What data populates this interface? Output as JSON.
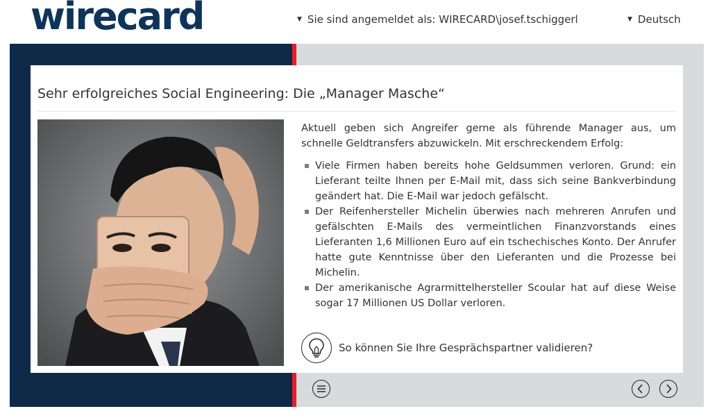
{
  "header": {
    "logo_text": "wirecard",
    "logged_in_label": "Sie sind angemeldet als: WIRECARD\\josef.tschiggerl",
    "language_label": "Deutsch"
  },
  "slide": {
    "title": "Sehr erfolgreiches Social Engineering: Die „Manager Masche“",
    "intro": "Aktuell geben sich Angreifer gerne als führende Manager aus, um schnelle Geldtransfers abzuwickeln. Mit erschreckendem Erfolg:",
    "bullets": [
      "Viele Firmen haben bereits hohe Geldsummen verloren. Grund: ein Lieferant teilte Ihnen per E-Mail mit, dass sich seine Bankverbindung geändert hat. Die E-Mail war jedoch gefälscht.",
      "Der Reifenhersteller Michelin überwies nach mehreren Anrufen und gefälschten E-Mails des vermeintlichen Finanzvorstands eines Lieferanten 1,6 Millionen Euro auf ein tschechisches Konto. Der Anrufer hatte gute Kenntnisse über den Lieferanten und die Prozesse bei Michelin.",
      "Der amerikanische Agrarmittelhersteller Scoular hat auf diese Weise sogar 17 Millionen US Dollar verloren."
    ],
    "tip_label": "So können Sie Ihre Gesprächspartner validieren?"
  },
  "icons": {
    "dropdown": "caret-down-icon",
    "tip": "lightbulb-icon",
    "menu": "menu-icon",
    "prev": "chevron-left-icon",
    "next": "chevron-right-icon"
  },
  "colors": {
    "brand_navy": "#0f3459",
    "panel_navy": "#0e2a48",
    "accent_red": "#e41f2b",
    "panel_gray": "#d9dadc"
  }
}
